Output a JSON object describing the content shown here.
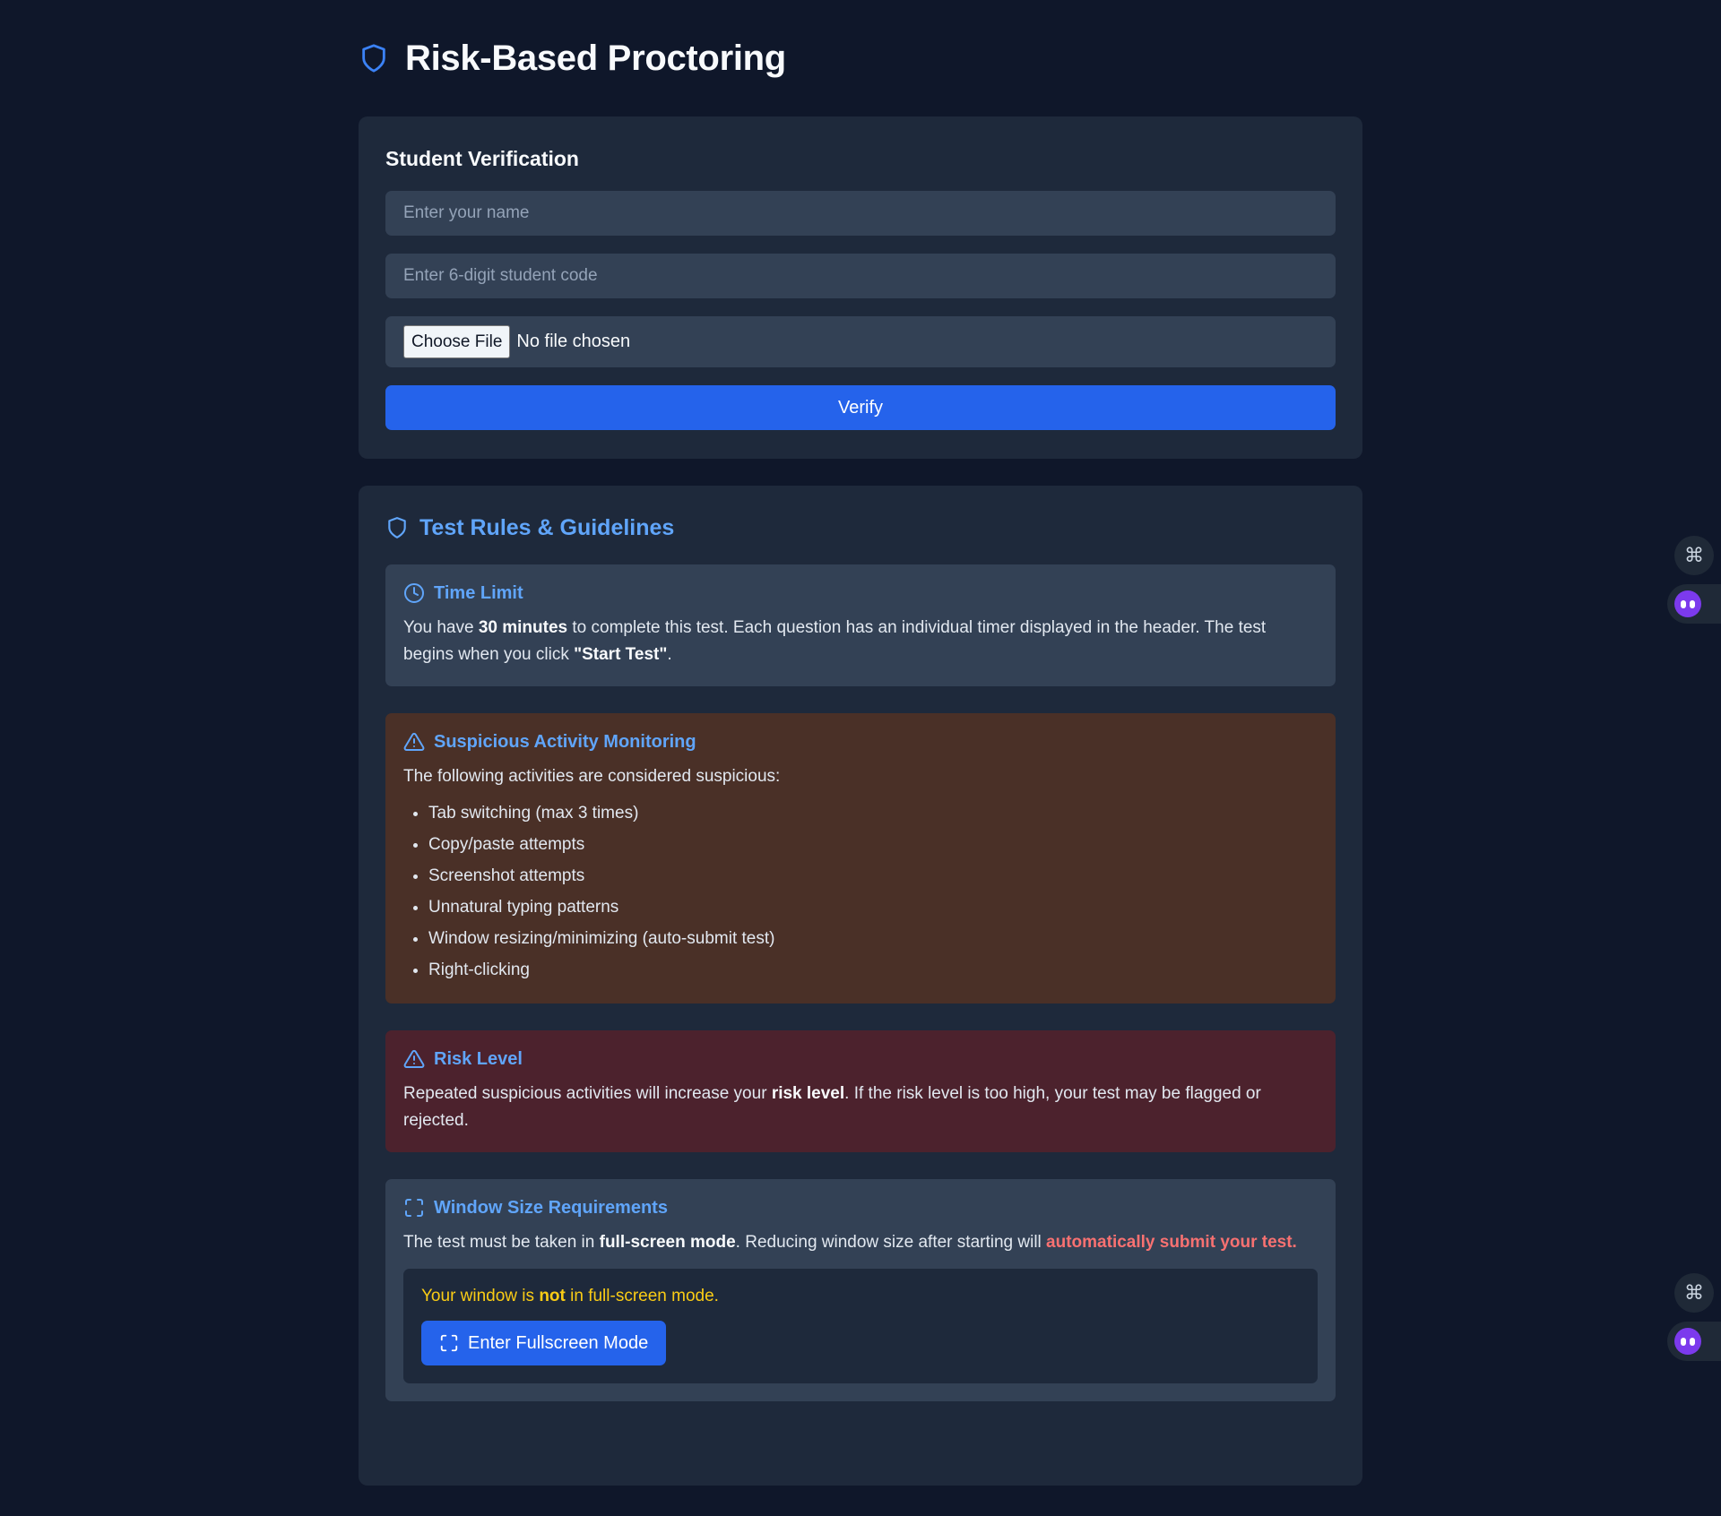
{
  "header": {
    "title": "Risk-Based Proctoring",
    "icon": "shield-icon"
  },
  "verification": {
    "title": "Student Verification",
    "name_placeholder": "Enter your name",
    "code_placeholder": "Enter 6-digit student code",
    "file_button": "Choose File",
    "file_status": "No file chosen",
    "verify_label": "Verify"
  },
  "rules": {
    "title": "Test Rules & Guidelines",
    "time_limit": {
      "title": "Time Limit",
      "text_1": "You have ",
      "bold_1": "30 minutes",
      "text_2": " to complete this test. Each question has an individual timer displayed in the header. The test begins when you click ",
      "bold_2": "\"Start Test\"",
      "text_3": "."
    },
    "suspicious": {
      "title": "Suspicious Activity Monitoring",
      "intro": "The following activities are considered suspicious:",
      "items": [
        "Tab switching (max 3 times)",
        "Copy/paste attempts",
        "Screenshot attempts",
        "Unnatural typing patterns",
        "Window resizing/minimizing (auto-submit test)",
        "Right-clicking"
      ]
    },
    "risk": {
      "title": "Risk Level",
      "text_1": "Repeated suspicious activities will increase your ",
      "bold_1": "risk level",
      "text_2": ". If the risk level is too high, your test may be flagged or rejected."
    },
    "window": {
      "title": "Window Size Requirements",
      "text_1": "The test must be taken in ",
      "bold_1": "full-screen mode",
      "text_2": ". Reducing window size after starting will ",
      "alert": "automatically submit your test.",
      "status_1": "Your window is ",
      "status_bold": "not",
      "status_2": " in full-screen mode.",
      "button": "Enter Fullscreen Mode"
    }
  },
  "colors": {
    "background": "#0f172a",
    "card": "#1e293b",
    "accent": "#2563eb",
    "heading_blue": "#60a5fa",
    "warning_bg": "#4a3027",
    "danger_bg": "#4c222d",
    "alert_red": "#f87171",
    "status_yellow": "#facc15"
  },
  "side_widgets": {
    "command_icon": "command-icon",
    "assistant_icon": "assistant-bot-icon"
  }
}
